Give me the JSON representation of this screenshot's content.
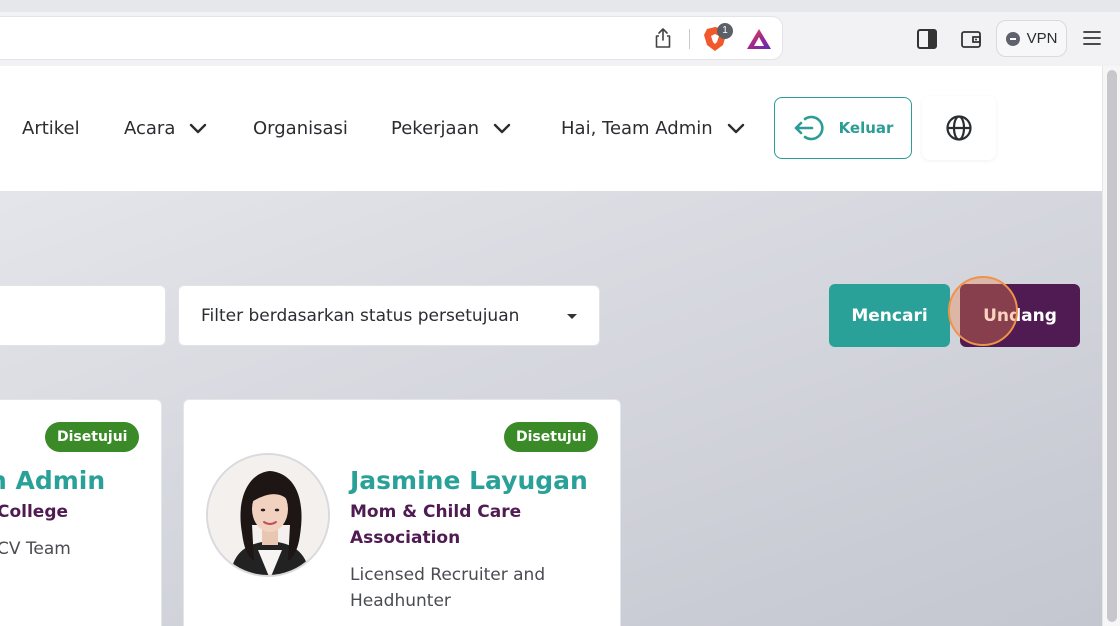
{
  "browser": {
    "brave_badge_count": "1",
    "vpn_label": "VPN"
  },
  "nav": {
    "items": [
      {
        "label": "Artikel"
      },
      {
        "label": "Acara"
      },
      {
        "label": "Organisasi"
      },
      {
        "label": "Pekerjaan"
      },
      {
        "label": "Hai, Team Admin"
      }
    ],
    "logout_label": "Keluar"
  },
  "filters": {
    "search_value": "",
    "approval_filter_placeholder": "Filter berdasarkan status persetujuan"
  },
  "actions": {
    "search_label": "Mencari",
    "invite_label": "Undang"
  },
  "members": [
    {
      "status": "Disetujui",
      "name": "n Admin",
      "org_line1": "College",
      "role": "CV Team"
    },
    {
      "status": "Disetujui",
      "name": "Jasmine Layugan",
      "org_line1": "Mom & Child Care",
      "org_line2": "Association",
      "role_line1": "Licensed Recruiter and",
      "role_line2": "Headhunter"
    }
  ],
  "colors": {
    "primary_teal": "#2aa198",
    "brand_purple": "#4f1b52",
    "approved_green": "#3a8a28"
  }
}
